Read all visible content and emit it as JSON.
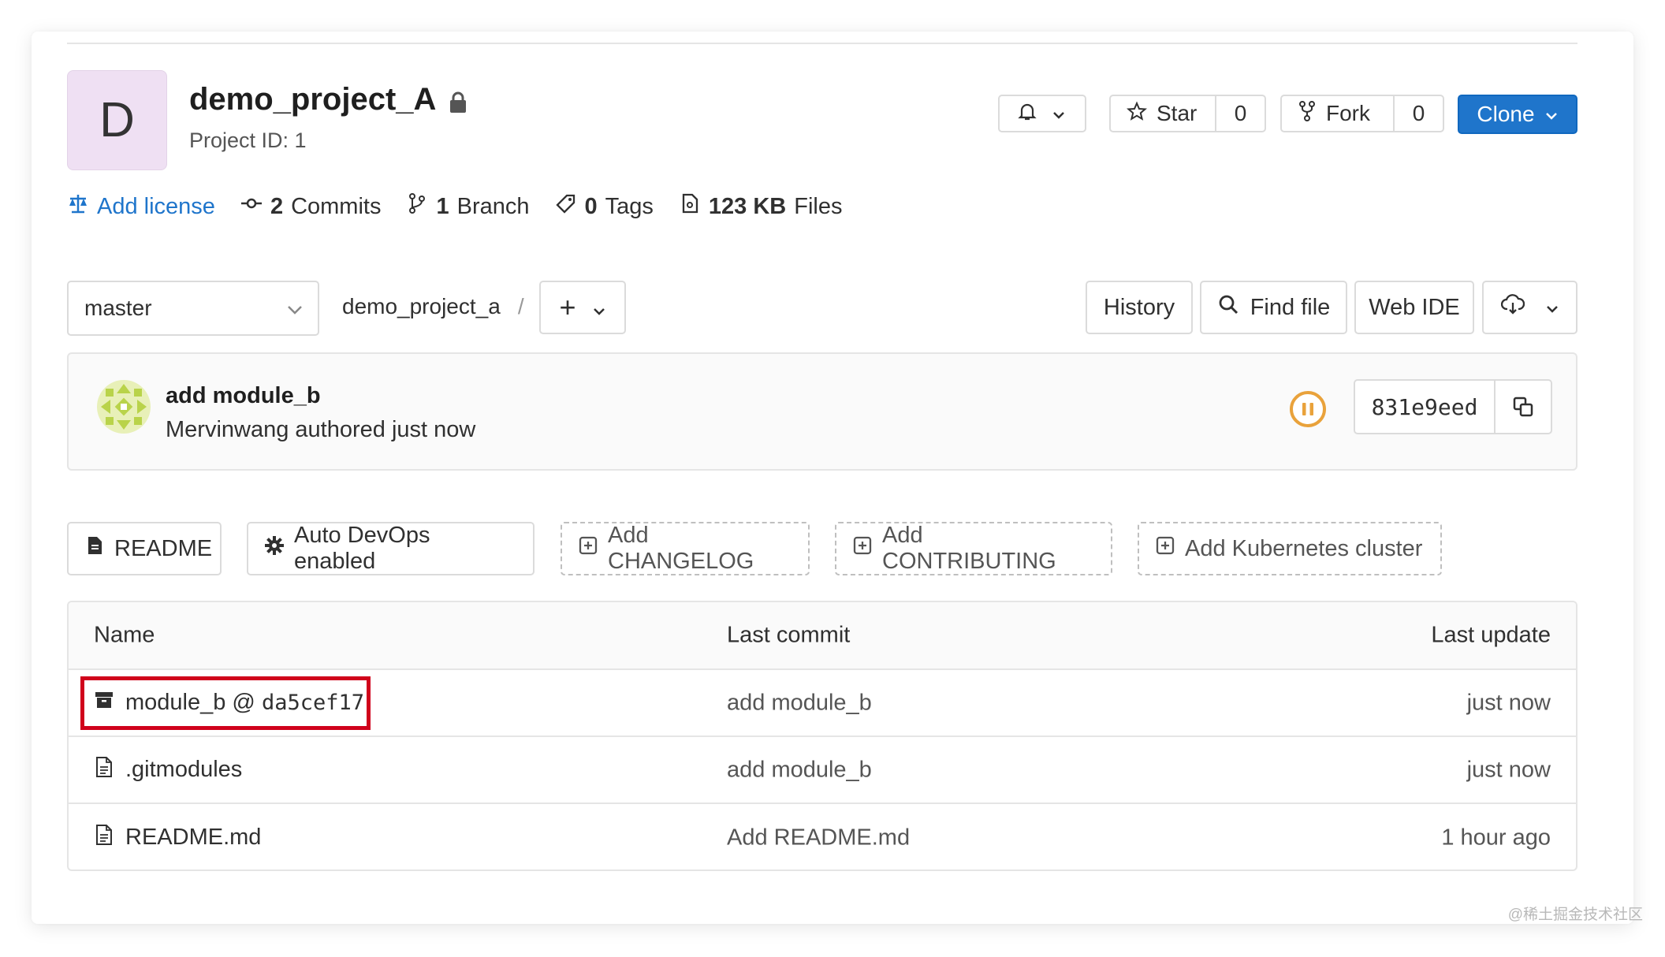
{
  "project": {
    "initial": "D",
    "name": "demo_project_A",
    "id_text": "Project ID: 1"
  },
  "header_buttons": {
    "star_label": "Star",
    "star_count": "0",
    "fork_label": "Fork",
    "fork_count": "0",
    "clone_label": "Clone"
  },
  "stats": {
    "license": "Add license",
    "commits_count": "2",
    "commits_label": "Commits",
    "branch_count": "1",
    "branch_label": "Branch",
    "tags_count": "0",
    "tags_label": "Tags",
    "files_size": "123 KB",
    "files_label": "Files"
  },
  "repo_nav": {
    "branch": "master",
    "path_root": "demo_project_a",
    "path_sep": "/",
    "plus": "+",
    "history": "History",
    "find_file": "Find file",
    "web_ide": "Web IDE"
  },
  "last_commit": {
    "title": "add module_b",
    "meta": "Mervinwang authored just now",
    "sha": "831e9eed"
  },
  "actions": {
    "readme": "README",
    "auto_devops": "Auto DevOps enabled",
    "add_changelog": "Add CHANGELOG",
    "add_contributing": "Add CONTRIBUTING",
    "add_k8s": "Add Kubernetes cluster"
  },
  "table": {
    "headers": {
      "name": "Name",
      "last_commit": "Last commit",
      "last_update": "Last update"
    },
    "rows": [
      {
        "name": "module_b @ ",
        "ref": "da5cef17",
        "commit": "add module_b",
        "updated": "just now"
      },
      {
        "name": ".gitmodules",
        "commit": "add module_b",
        "updated": "just now"
      },
      {
        "name": "README.md",
        "commit": "Add README.md",
        "updated": "1 hour ago"
      }
    ]
  },
  "watermark": "@稀土掘金技术社区",
  "colors": {
    "accent": "#1f75cb",
    "highlight": "#d0021b",
    "pipeline": "#e9a23b"
  }
}
